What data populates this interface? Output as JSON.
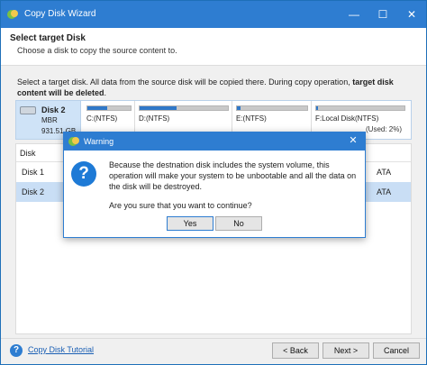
{
  "window": {
    "title": "Copy Disk Wizard",
    "minimize_glyph": "—",
    "maximize_glyph": "☐",
    "close_glyph": "✕"
  },
  "header": {
    "title": "Select target Disk",
    "subtitle": "Choose a disk to copy the source content to."
  },
  "instructions": {
    "text": "Select a target disk. All data from the source disk will be copied there. During copy operation, ",
    "bold": "target disk content will be deleted",
    "end": "."
  },
  "disk_map": {
    "name": "Disk 2",
    "type": "MBR",
    "size": "931.51 GB",
    "partitions": [
      {
        "label": "C:(NTFS)",
        "detail": "",
        "used_fraction": 0.45
      },
      {
        "label": "D:(NTFS)",
        "detail": "",
        "used_fraction": 0.42
      },
      {
        "label": "E:(NTFS)",
        "detail": "",
        "used_fraction": 0.05
      },
      {
        "label": "F:Local Disk(NTFS)",
        "detail": "(Used: 2%)",
        "used_fraction": 0.02
      }
    ]
  },
  "disk_table": {
    "header": "Disk",
    "rows": [
      {
        "name": "Disk 1",
        "tail": "ATA"
      },
      {
        "name": "Disk 2",
        "tail": "ATA"
      }
    ],
    "selected_row": 1
  },
  "footer": {
    "help_icon": "?",
    "help_link": "Copy Disk Tutorial",
    "back": "< Back",
    "next": "Next >",
    "cancel": "Cancel"
  },
  "dialog": {
    "title": "Warning",
    "close_glyph": "✕",
    "icon_glyph": "?",
    "message": "Because the destnation disk includes the system volume, this operation will make your system to be unbootable and all the data on the disk will be destroyed.",
    "question": "Are you sure that you want to continue?",
    "yes": "Yes",
    "no": "No"
  },
  "colors": {
    "accent": "#2e7dd1",
    "selection": "#c9def5",
    "bar_fill": "#2f78c9"
  }
}
